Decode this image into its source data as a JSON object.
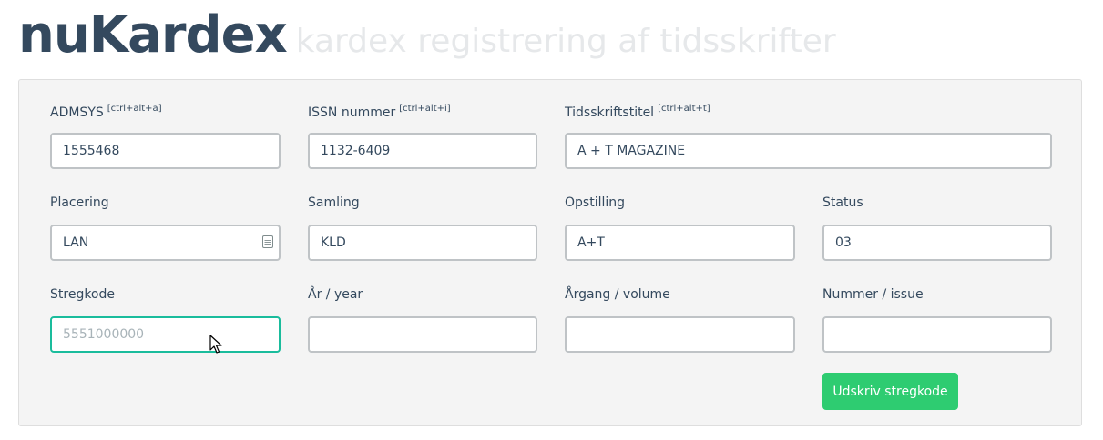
{
  "header": {
    "brand": "nuKardex",
    "subtitle": "kardex registrering af tidsskrifter"
  },
  "form": {
    "admsys": {
      "label": "ADMSYS",
      "shortcut": "[ctrl+alt+a]",
      "value": "1555468"
    },
    "issn": {
      "label": "ISSN nummer",
      "shortcut": "[ctrl+alt+i]",
      "value": "1132-6409"
    },
    "titel": {
      "label": "Tidsskriftstitel",
      "shortcut": "[ctrl+alt+t]",
      "value": "A + T MAGAZINE"
    },
    "placering": {
      "label": "Placering",
      "value": "LAN"
    },
    "samling": {
      "label": "Samling",
      "value": "KLD"
    },
    "opstilling": {
      "label": "Opstilling",
      "value": "A+T"
    },
    "status": {
      "label": "Status",
      "value": "03"
    },
    "stregkode": {
      "label": "Stregkode",
      "value": "",
      "placeholder": "5551000000"
    },
    "aar": {
      "label": "År / year",
      "value": ""
    },
    "aargang": {
      "label": "Årgang / volume",
      "value": ""
    },
    "nummer": {
      "label": "Nummer / issue",
      "value": ""
    },
    "print_button": "Udskriv stregkode"
  },
  "colors": {
    "accent_focus": "#1abc9c",
    "button": "#2ecc71",
    "brand": "#34495e"
  },
  "icons": {
    "placering_icon": "contact-card-icon",
    "cursor": "mouse-pointer-icon"
  }
}
